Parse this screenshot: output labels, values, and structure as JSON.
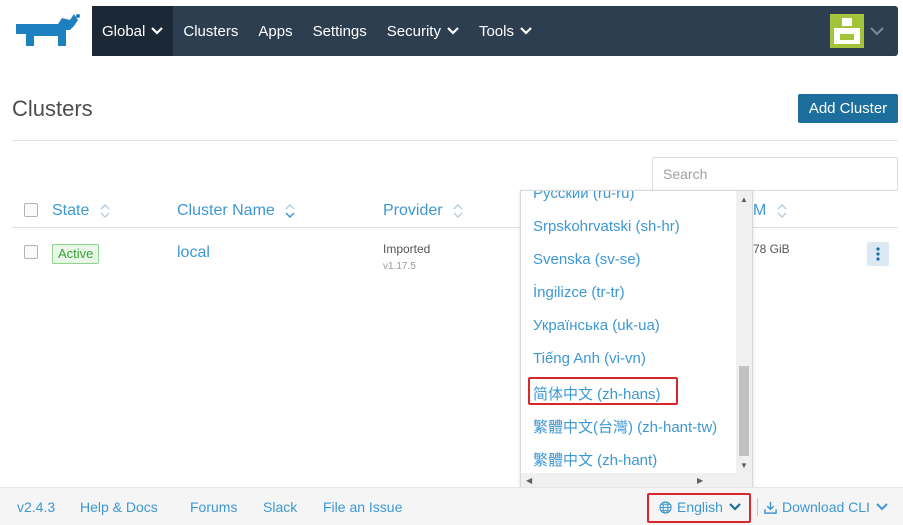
{
  "nav": {
    "items": [
      {
        "label": "Global",
        "dropdown": true,
        "active": true
      },
      {
        "label": "Clusters",
        "dropdown": false,
        "active": false
      },
      {
        "label": "Apps",
        "dropdown": false,
        "active": false
      },
      {
        "label": "Settings",
        "dropdown": false,
        "active": false
      },
      {
        "label": "Security",
        "dropdown": true,
        "active": false
      },
      {
        "label": "Tools",
        "dropdown": true,
        "active": false
      }
    ]
  },
  "page": {
    "title": "Clusters",
    "add_button": "Add Cluster",
    "search_placeholder": "Search"
  },
  "table": {
    "columns": [
      "State",
      "Cluster Name",
      "Provider",
      "RAM"
    ],
    "ram_header_visible": "M",
    "rows": [
      {
        "state": "Active",
        "name": "local",
        "provider": "Imported",
        "version": "v1.17.5",
        "ram_visible": "78 GiB"
      }
    ]
  },
  "language_menu": {
    "items": [
      "Русский (ru-ru)",
      "Srpskohrvatski (sh-hr)",
      "Svenska (sv-se)",
      "İngilizce (tr-tr)",
      "Українська (uk-ua)",
      "Tiếng Anh (vi-vn)",
      "简体中文 (zh-hans)",
      "繁體中文(台灣) (zh-hant-tw)",
      "繁體中文 (zh-hant)"
    ],
    "highlighted": "简体中文 (zh-hans)"
  },
  "footer": {
    "version": "v2.4.3",
    "links": [
      "Help & Docs",
      "Forums",
      "Slack",
      "File an Issue"
    ],
    "language": "English",
    "download": "Download CLI"
  },
  "colors": {
    "nav_bg": "#2d3e50",
    "link": "#3d98d3",
    "primary_button": "#1c6f9c",
    "highlight": "#d9262b",
    "active_badge": "#35a335"
  }
}
